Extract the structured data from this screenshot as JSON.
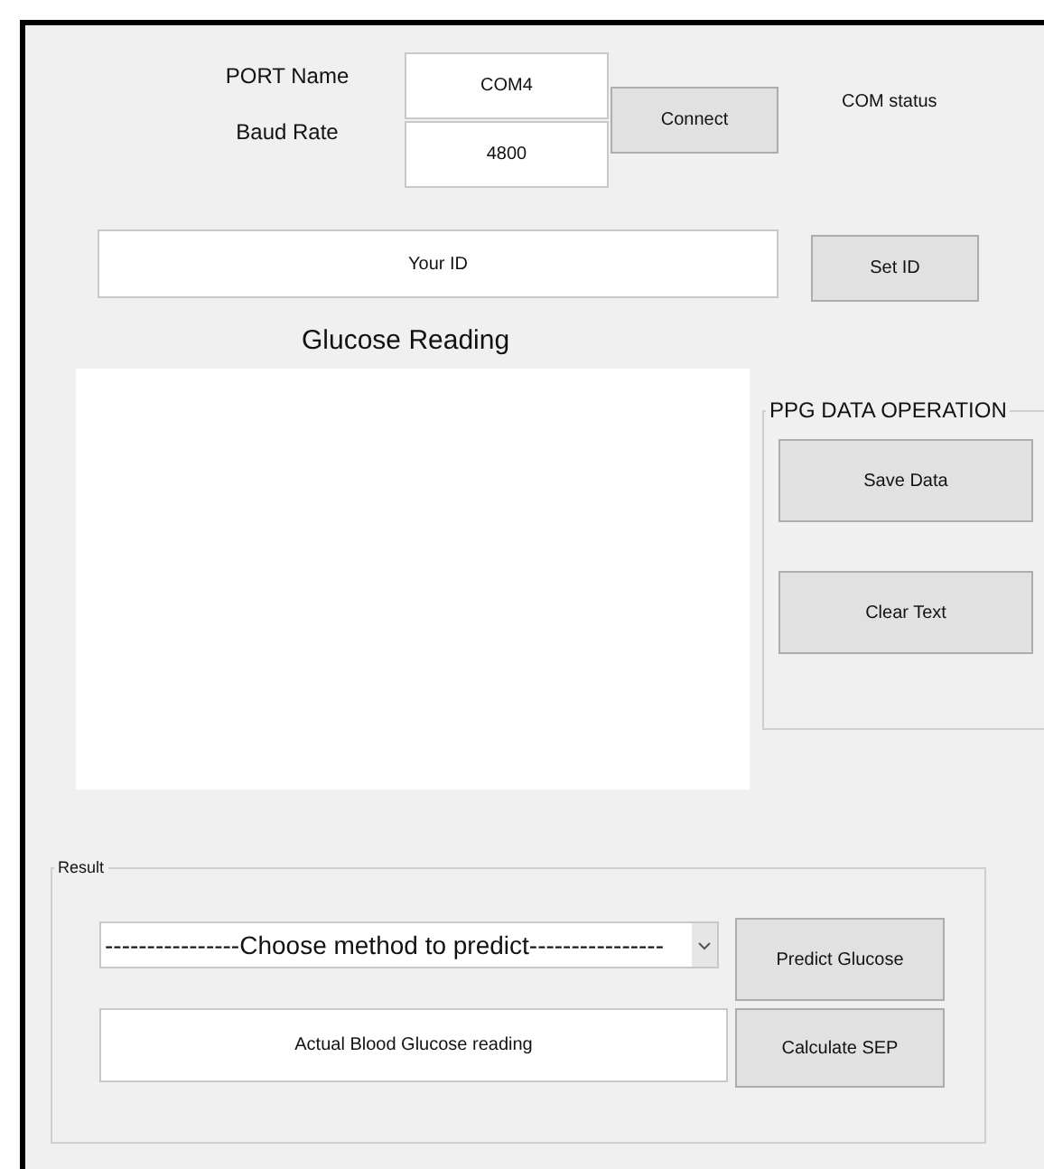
{
  "connection": {
    "port_label": "PORT Name",
    "port_value": "COM4",
    "baud_label": "Baud Rate",
    "baud_value": "4800",
    "connect_button": "Connect",
    "com_status": "COM status"
  },
  "id_field": {
    "value": "Your ID"
  },
  "set_id_button": "Set ID",
  "reading_title": "Glucose Reading",
  "ppg_group": {
    "title": "PPG DATA OPERATION",
    "buttons": [
      "Save Data",
      "Clear Text"
    ]
  },
  "result_group": {
    "title": "Result",
    "method_dropdown": {
      "value": "----------------Choose method to predict----------------"
    },
    "predict_button": "Predict Glucose",
    "actual_field": {
      "value": "Actual Blood Glucose reading"
    },
    "calculate_button": "Calculate SEP"
  }
}
